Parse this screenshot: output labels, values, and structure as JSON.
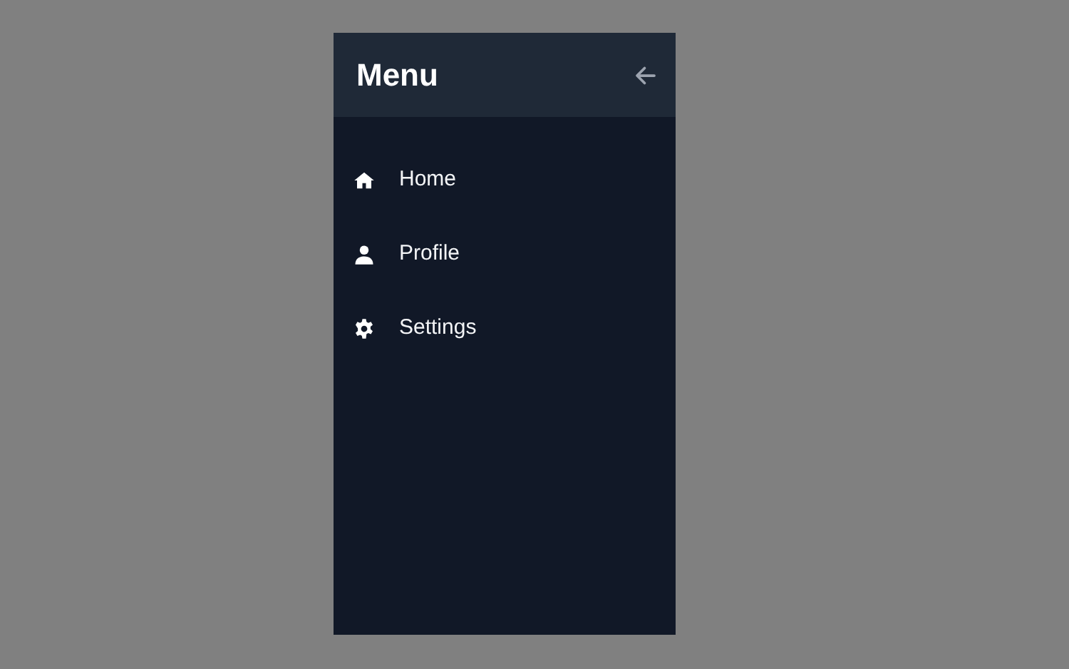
{
  "sidebar": {
    "title": "Menu",
    "items": [
      {
        "kind": "home",
        "label": "Home"
      },
      {
        "kind": "user",
        "label": "Profile"
      },
      {
        "kind": "gear",
        "label": "Settings"
      }
    ]
  }
}
